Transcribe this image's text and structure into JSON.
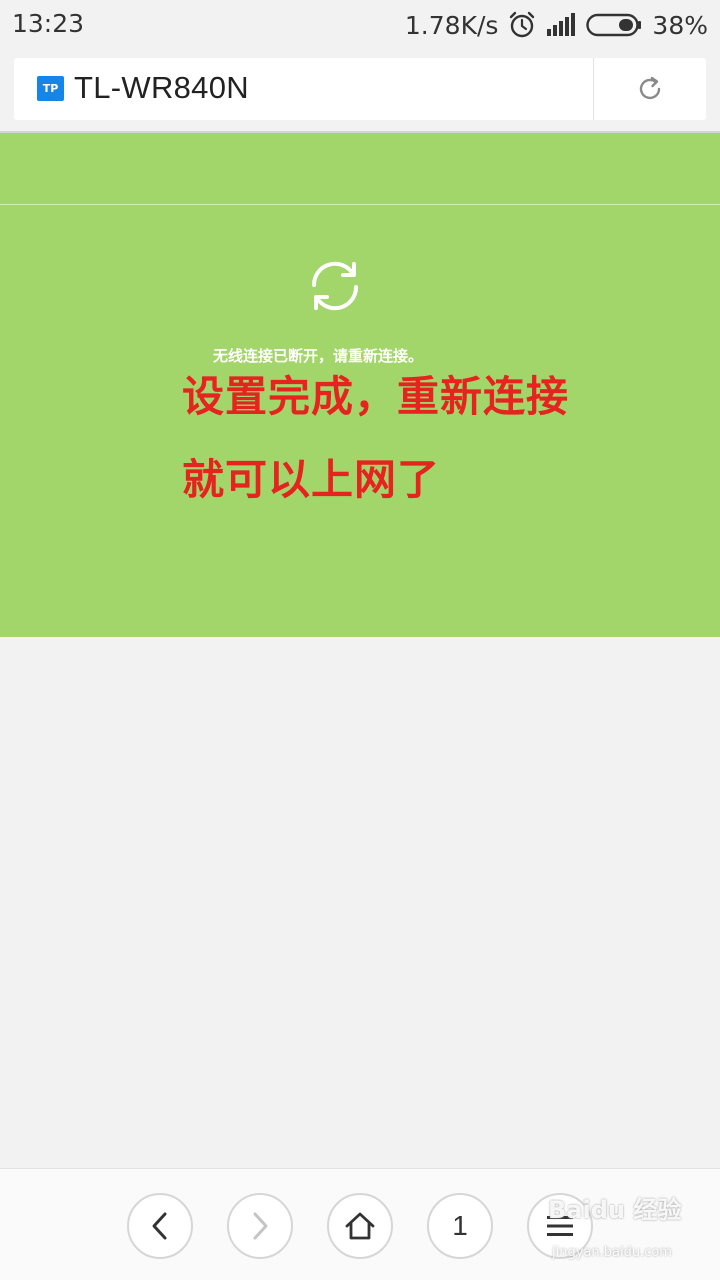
{
  "status_bar": {
    "time": "13:23",
    "network_speed": "1.78K/s",
    "battery_percent": "38%",
    "battery_level": 0.38
  },
  "address_bar": {
    "logo_text": "TP",
    "title": "TL-WR840N",
    "reload_icon": "reload-icon"
  },
  "content": {
    "status_icon": "sync-icon",
    "disconnect_message": "无线连接已断开，请重新连接。",
    "annotation_line1": "设置完成，重新连接",
    "annotation_line2": "就可以上网了"
  },
  "toolbar": {
    "tab_count": "1",
    "buttons": [
      "back-icon",
      "forward-icon",
      "home-icon",
      "tabs",
      "menu-icon"
    ]
  },
  "watermark": {
    "text": "Baidu 经验",
    "url": "jingyan.baidu.com"
  },
  "colors": {
    "green_panel": "#a3d66a",
    "annotation_red": "#e5231f",
    "tp_blue": "#1685e8"
  }
}
